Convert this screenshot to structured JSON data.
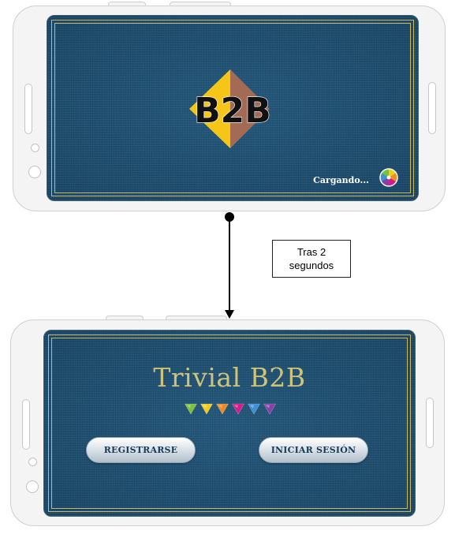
{
  "loading_screen": {
    "logo_text": "B2B",
    "loading_label": "Cargando...",
    "colors": {
      "logo_left": "#f5c518",
      "logo_right": "#a36b55",
      "background": "#1e4d6e"
    }
  },
  "transition": {
    "note": "Tras 2\nsegundos"
  },
  "home_screen": {
    "title": "Trivial B2B",
    "register_button": "REGISTRARSE",
    "login_button": "INICIAR SESIÓN",
    "category_colors": [
      "#7cbf3a",
      "#f2cc1d",
      "#f08a24",
      "#d9198a",
      "#3d8fd8",
      "#8a3fa3"
    ]
  }
}
